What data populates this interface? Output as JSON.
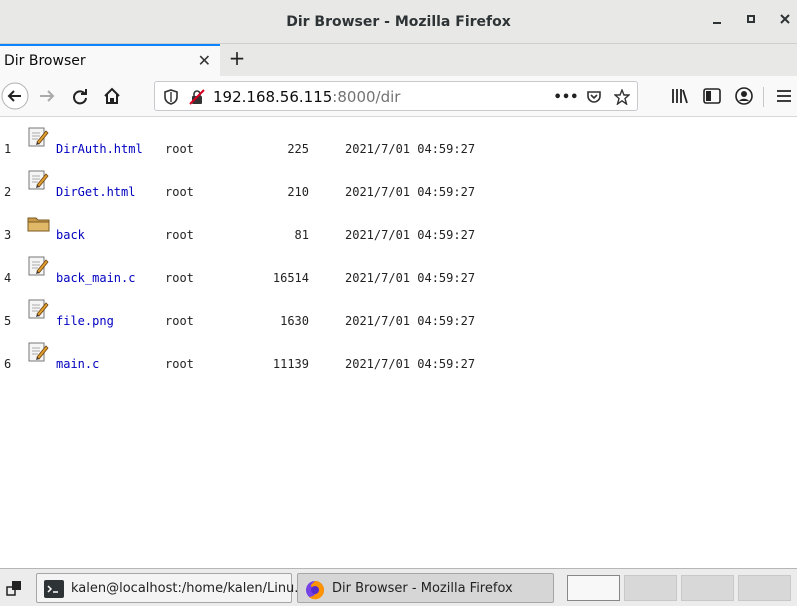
{
  "window": {
    "title": "Dir Browser - Mozilla Firefox",
    "minimize_icon": "minimize-icon",
    "maximize_icon": "maximize-icon",
    "close_icon": "close-icon"
  },
  "tabs": [
    {
      "label": "Dir Browser",
      "active": true
    }
  ],
  "tabstrip": {
    "new_tab_glyph": "+"
  },
  "navbar": {
    "url_host": "192.168.56.115",
    "url_rest": ":8000/dir",
    "page_actions_glyph": "•••"
  },
  "listing": {
    "rows": [
      {
        "index": "1",
        "name": "DirAuth.html",
        "type": "file",
        "owner": "root",
        "size": "225",
        "modified": "2021/7/01 04:59:27"
      },
      {
        "index": "2",
        "name": "DirGet.html",
        "type": "file",
        "owner": "root",
        "size": "210",
        "modified": "2021/7/01 04:59:27"
      },
      {
        "index": "3",
        "name": "back",
        "type": "folder",
        "owner": "root",
        "size": "81",
        "modified": "2021/7/01 04:59:27"
      },
      {
        "index": "4",
        "name": "back_main.c",
        "type": "file",
        "owner": "root",
        "size": "16514",
        "modified": "2021/7/01 04:59:27"
      },
      {
        "index": "5",
        "name": "file.png",
        "type": "file",
        "owner": "root",
        "size": "1630",
        "modified": "2021/7/01 04:59:27"
      },
      {
        "index": "6",
        "name": "main.c",
        "type": "file",
        "owner": "root",
        "size": "11139",
        "modified": "2021/7/01 04:59:27"
      }
    ]
  },
  "taskbar": {
    "tasks": [
      {
        "label": "kalen@localhost:/home/kalen/Linu...",
        "icon": "terminal-icon",
        "active": false
      },
      {
        "label": "Dir Browser - Mozilla Firefox",
        "icon": "firefox-icon",
        "active": true
      }
    ],
    "workspaces": 4,
    "active_workspace": 1
  },
  "colors": {
    "link": "#0000c0",
    "tab_accent": "#0a84ff",
    "chrome_bg": "#e8e8e7"
  }
}
